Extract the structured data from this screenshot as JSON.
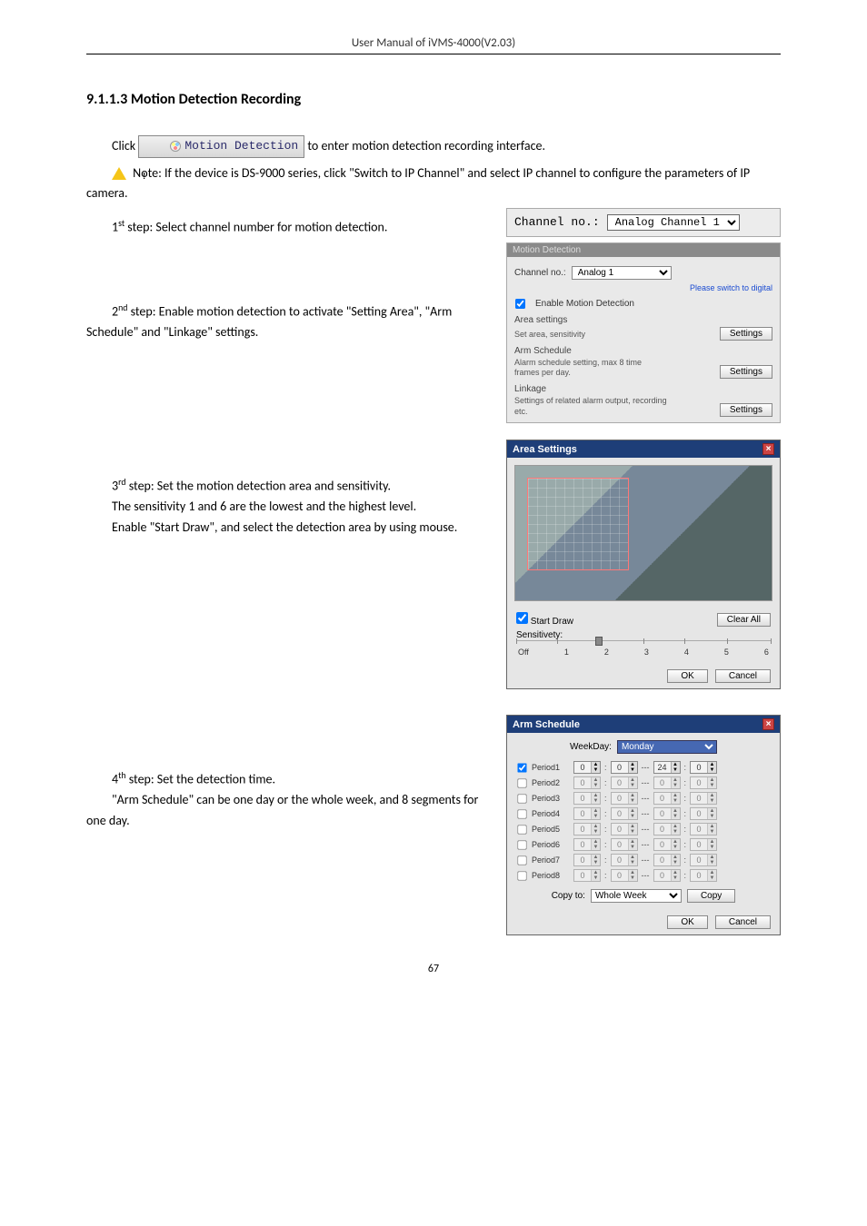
{
  "header": {
    "title": "User Manual of iVMS-4000(V2.03)"
  },
  "section": {
    "heading": "9.1.1.3 Motion Detection Recording"
  },
  "intro": {
    "click_prefix": "Click",
    "motion_btn": "Motion Detection",
    "click_suffix": " to enter motion detection recording interface.",
    "note": "Note: If the device is DS-9000 series, click \"Switch to IP Channel\" and select IP channel to configure the parameters of IP camera."
  },
  "steps": {
    "s1": "1st step: Select channel number for motion detection.",
    "s2": "2nd step: Enable motion detection to activate \"Setting Area\", \"Arm Schedule\" and \"Linkage\" settings.",
    "s3a": "3rd step: Set the motion detection area and sensitivity.",
    "s3b": "The sensitivity 1 and 6 are the lowest and the highest level.",
    "s3c": "Enable \"Start Draw\", and select the detection area by using mouse.",
    "s4a": "4th step: Set the detection time.",
    "s4b": "\"Arm Schedule\" can be one day or the whole week, and 8 segments for one day."
  },
  "chan_strip": {
    "label": "Channel no.:",
    "value": "Analog Channel 1"
  },
  "md_panel": {
    "bar": "Motion Detection",
    "chan_label": "Channel no.:",
    "chan_value": "Analog 1",
    "switch_link": "Please switch to digital",
    "enable_label": "Enable Motion Detection",
    "area": {
      "title": "Area settings",
      "desc": "Set area, sensitivity",
      "btn": "Settings"
    },
    "arm": {
      "title": "Arm Schedule",
      "desc": "Alarm schedule setting, max 8 time frames per day.",
      "btn": "Settings"
    },
    "linkage": {
      "title": "Linkage",
      "desc": "Settings of related alarm output, recording etc.",
      "btn": "Settings"
    }
  },
  "area_dlg": {
    "title": "Area Settings",
    "start_draw": "Start Draw",
    "clear_all": "Clear All",
    "sens_label": "Sensitivety:",
    "sens_ticks": [
      "Off",
      "1",
      "2",
      "3",
      "4",
      "5",
      "6"
    ],
    "ok": "OK",
    "cancel": "Cancel"
  },
  "arm_dlg": {
    "title": "Arm Schedule",
    "weekday_label": "WeekDay:",
    "weekday_value": "Monday",
    "periods": [
      {
        "label": "Period1",
        "checked": true,
        "h1": "0",
        "m1": "0",
        "h2": "24",
        "m2": "0",
        "enabled": true
      },
      {
        "label": "Period2",
        "checked": false,
        "h1": "0",
        "m1": "0",
        "h2": "0",
        "m2": "0",
        "enabled": false
      },
      {
        "label": "Period3",
        "checked": false,
        "h1": "0",
        "m1": "0",
        "h2": "0",
        "m2": "0",
        "enabled": false
      },
      {
        "label": "Period4",
        "checked": false,
        "h1": "0",
        "m1": "0",
        "h2": "0",
        "m2": "0",
        "enabled": false
      },
      {
        "label": "Period5",
        "checked": false,
        "h1": "0",
        "m1": "0",
        "h2": "0",
        "m2": "0",
        "enabled": false
      },
      {
        "label": "Period6",
        "checked": false,
        "h1": "0",
        "m1": "0",
        "h2": "0",
        "m2": "0",
        "enabled": false
      },
      {
        "label": "Period7",
        "checked": false,
        "h1": "0",
        "m1": "0",
        "h2": "0",
        "m2": "0",
        "enabled": false
      },
      {
        "label": "Period8",
        "checked": false,
        "h1": "0",
        "m1": "0",
        "h2": "0",
        "m2": "0",
        "enabled": false
      }
    ],
    "copy_label": "Copy to:",
    "copy_value": "Whole Week",
    "copy_btn": "Copy",
    "ok": "OK",
    "cancel": "Cancel"
  },
  "page_number": "67"
}
